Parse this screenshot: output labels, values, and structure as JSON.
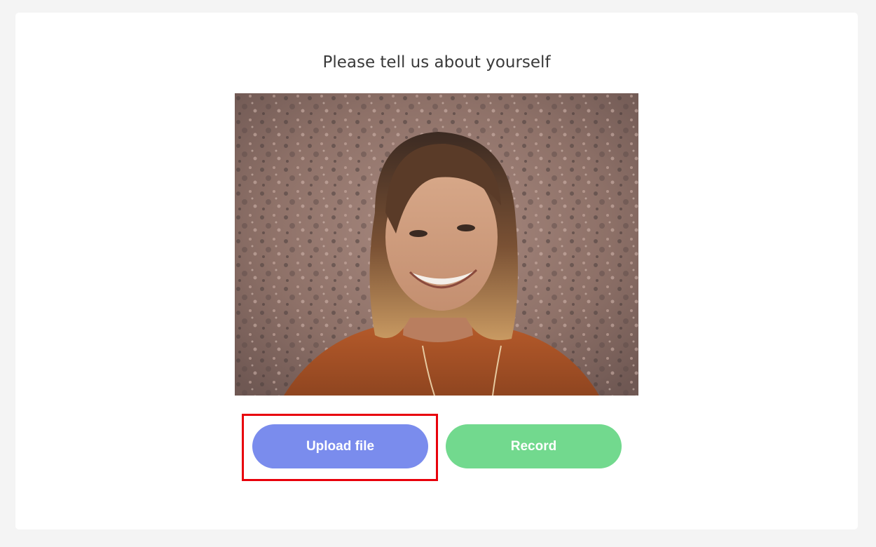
{
  "page": {
    "title": "Please tell us about yourself"
  },
  "photo": {
    "description_icon": "portrait-photo"
  },
  "buttons": {
    "upload_label": "Upload file",
    "record_label": "Record"
  },
  "colors": {
    "upload_button": "#7a8ced",
    "record_button": "#72d98e",
    "highlight_border": "#e8000b",
    "page_background": "#f4f4f4",
    "card_background": "#ffffff"
  }
}
